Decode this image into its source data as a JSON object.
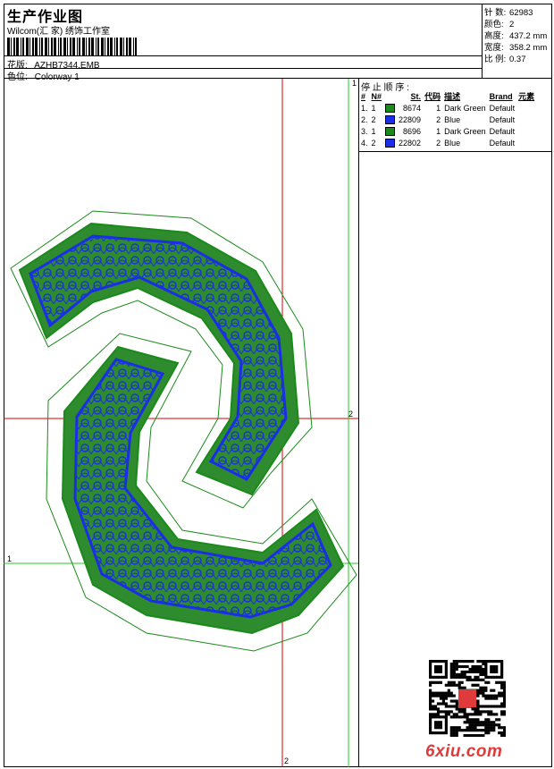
{
  "header": {
    "title": "生产作业图",
    "company": "Wilcom(汇 家) 绣饰工作室",
    "design_label": "花版:",
    "design_value": "AZHB7344.EMB",
    "colorway_label": "色位:",
    "colorway_value": "Colorway 1"
  },
  "meta": {
    "stitches_label": "针 数:",
    "stitches_value": "62983",
    "colors_label": "颜色:",
    "colors_value": "2",
    "height_label": "高度:",
    "height_value": "437.2 mm",
    "width_label": "宽度:",
    "width_value": "358.2 mm",
    "scale_label": "比 例:",
    "scale_value": "0.37"
  },
  "stop_sequence": {
    "title": "停 止 顺 序 :",
    "columns": [
      "#",
      "N#",
      "St.",
      "代码",
      "描述",
      "Brand",
      "元素"
    ],
    "rows": [
      {
        "num": "1.",
        "n": "1",
        "color": "#1a8a1a",
        "st": "8674",
        "code": "1",
        "desc": "Dark Green",
        "brand": "Default"
      },
      {
        "num": "2.",
        "n": "2",
        "color": "#1a2ee8",
        "st": "22809",
        "code": "2",
        "desc": "Blue",
        "brand": "Default"
      },
      {
        "num": "3.",
        "n": "1",
        "color": "#1a8a1a",
        "st": "8696",
        "code": "1",
        "desc": "Dark Green",
        "brand": "Default"
      },
      {
        "num": "4.",
        "n": "2",
        "color": "#1a2ee8",
        "st": "22802",
        "code": "2",
        "desc": "Blue",
        "brand": "Default"
      }
    ]
  },
  "guides": {
    "v1": "1",
    "h1": "1",
    "h2": "2",
    "v2": "2"
  },
  "watermark": {
    "site": "6xiu.com",
    "qr_icon": "qr-code-icon"
  },
  "colors": {
    "thread_green": "#1a8a1a",
    "thread_blue": "#1a2ee8",
    "guide_red": "#d80000",
    "guide_green": "#22cc22"
  }
}
